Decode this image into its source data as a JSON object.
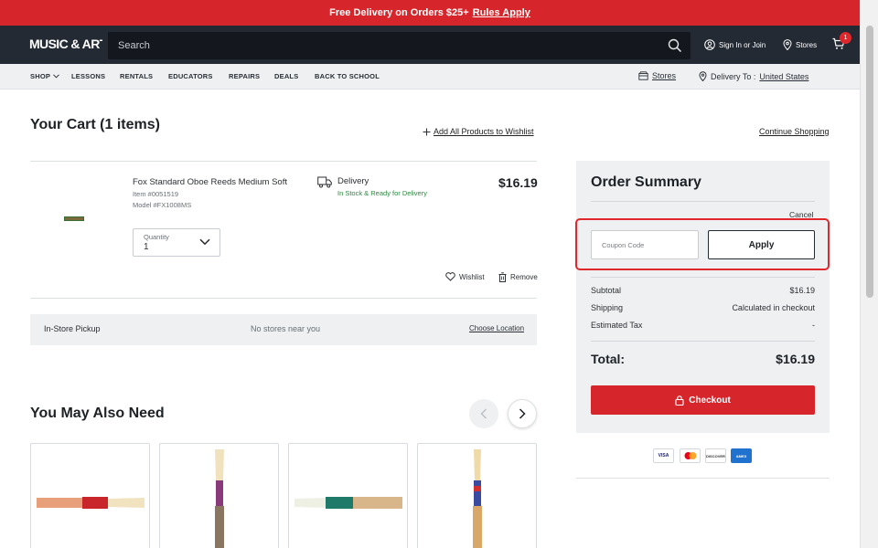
{
  "promo": {
    "text": "Free Delivery on Orders $25+",
    "link": "Rules Apply"
  },
  "header": {
    "logo": "MUSIC & ARTS",
    "search_placeholder": "Search",
    "sign_in": "Sign In or Join",
    "stores": "Stores",
    "cart_count": "1"
  },
  "nav": {
    "items": [
      "SHOP",
      "LESSONS",
      "RENTALS",
      "EDUCATORS",
      "REPAIRS",
      "DEALS",
      "BACK TO SCHOOL"
    ],
    "stores_link": "Stores",
    "delivery_label": "Delivery To :",
    "delivery_country": "United States"
  },
  "cart": {
    "title": "Your Cart (1 items)",
    "add_all_wishlist": "Add All Products to Wishlist",
    "continue_shopping": "Continue Shopping",
    "item": {
      "name": "Fox Standard Oboe Reeds Medium Soft",
      "item_no": "Item #0051519",
      "model": "Model #FX1008MS",
      "quantity_label": "Quantity",
      "quantity": "1",
      "delivery": "Delivery",
      "stock": "In Stock & Ready for Delivery",
      "price": "$16.19",
      "wishlist": "Wishlist",
      "remove": "Remove"
    },
    "pickup": {
      "label": "In-Store Pickup",
      "status": "No stores near you",
      "action": "Choose Location"
    }
  },
  "also_need": {
    "title": "You May Also Need"
  },
  "summary": {
    "title": "Order Summary",
    "cancel": "Cancel",
    "coupon_placeholder": "Coupon Code",
    "apply": "Apply",
    "subtotal_label": "Subtotal",
    "subtotal": "$16.19",
    "shipping_label": "Shipping",
    "shipping": "Calculated in checkout",
    "tax_label": "Estimated Tax",
    "tax": "-",
    "total_label": "Total:",
    "total": "$16.19",
    "checkout": "Checkout",
    "payments": [
      "VISA",
      "mastercard",
      "DISCOVER",
      "AMEX"
    ]
  },
  "colors": {
    "brand_red": "#d6262b",
    "header_dark": "#232a33",
    "in_stock_green": "#2a8a3e"
  }
}
